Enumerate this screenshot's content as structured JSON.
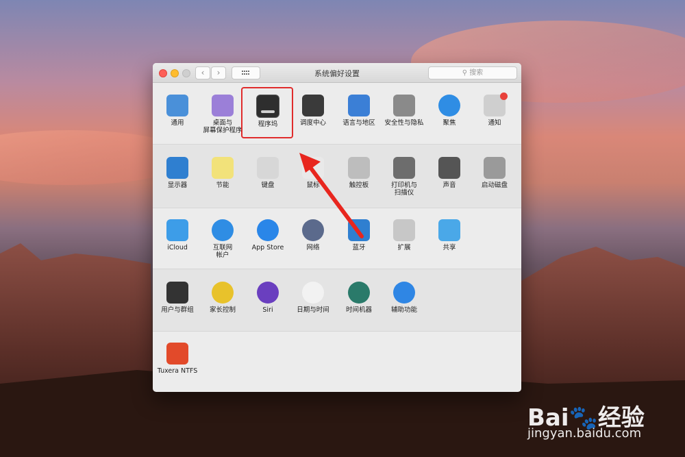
{
  "window": {
    "title": "系统偏好设置",
    "search_placeholder": "搜索",
    "back_glyph": "‹",
    "forward_glyph": "›"
  },
  "sections": [
    {
      "items": [
        {
          "label": "通用",
          "icon": "general-icon",
          "color": "#4a90d9"
        },
        {
          "label": "桌面与\n屏幕保护程序",
          "icon": "desktop-icon",
          "color": "#9b7fd8"
        },
        {
          "label": "程序坞",
          "icon": "dock-icon",
          "color": "#2e2e2e"
        },
        {
          "label": "调度中心",
          "icon": "mission-control-icon",
          "color": "#3a3a3a"
        },
        {
          "label": "语言与地区",
          "icon": "language-icon",
          "color": "#3b7fd6"
        },
        {
          "label": "安全性与隐私",
          "icon": "security-icon",
          "color": "#8a8a8a"
        },
        {
          "label": "聚焦",
          "icon": "spotlight-icon",
          "color": "#2f8de4"
        },
        {
          "label": "通知",
          "icon": "notifications-icon",
          "color": "#cfcfcf"
        }
      ]
    },
    {
      "items": [
        {
          "label": "显示器",
          "icon": "displays-icon",
          "color": "#2f7fd0"
        },
        {
          "label": "节能",
          "icon": "energy-saver-icon",
          "color": "#f2e27a"
        },
        {
          "label": "键盘",
          "icon": "keyboard-icon",
          "color": "#d7d7d7"
        },
        {
          "label": "鼠标",
          "icon": "mouse-icon",
          "color": "#e9e9e9"
        },
        {
          "label": "触控板",
          "icon": "trackpad-icon",
          "color": "#bdbdbd"
        },
        {
          "label": "打印机与\n扫描仪",
          "icon": "printer-icon",
          "color": "#6d6d6d"
        },
        {
          "label": "声音",
          "icon": "sound-icon",
          "color": "#555555"
        },
        {
          "label": "启动磁盘",
          "icon": "startup-disk-icon",
          "color": "#9a9a9a"
        }
      ]
    },
    {
      "items": [
        {
          "label": "iCloud",
          "icon": "icloud-icon",
          "color": "#3d9de8"
        },
        {
          "label": "互联网\n帐户",
          "icon": "internet-accounts-icon",
          "color": "#2f8de4"
        },
        {
          "label": "App Store",
          "icon": "app-store-icon",
          "color": "#2a86e8"
        },
        {
          "label": "网络",
          "icon": "network-icon",
          "color": "#5b6a8c"
        },
        {
          "label": "蓝牙",
          "icon": "bluetooth-icon",
          "color": "#2f7fd0"
        },
        {
          "label": "扩展",
          "icon": "extensions-icon",
          "color": "#c7c7c7"
        },
        {
          "label": "共享",
          "icon": "sharing-icon",
          "color": "#4aa8e8"
        }
      ]
    },
    {
      "items": [
        {
          "label": "用户与群组",
          "icon": "users-groups-icon",
          "color": "#333333"
        },
        {
          "label": "家长控制",
          "icon": "parental-controls-icon",
          "color": "#e8c22b"
        },
        {
          "label": "Siri",
          "icon": "siri-icon",
          "color": "#6a3fbf"
        },
        {
          "label": "日期与时间",
          "icon": "date-time-icon",
          "color": "#f2f2f2"
        },
        {
          "label": "时间机器",
          "icon": "time-machine-icon",
          "color": "#2a7a6a"
        },
        {
          "label": "辅助功能",
          "icon": "accessibility-icon",
          "color": "#2f86e4"
        }
      ]
    },
    {
      "items": [
        {
          "label": "Tuxera NTFS",
          "icon": "tuxera-icon",
          "color": "#e24a2a"
        }
      ]
    }
  ],
  "watermark": {
    "logo": "Bai🐾经验",
    "url": "jingyan.baidu.com"
  }
}
